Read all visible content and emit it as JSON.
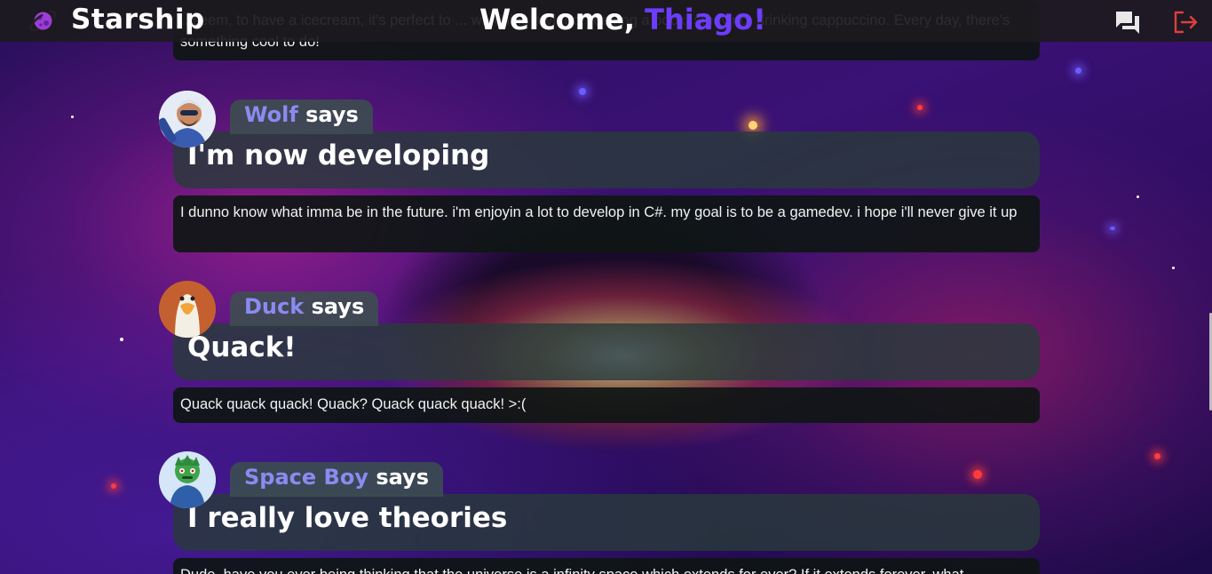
{
  "app": {
    "title": "Starship",
    "logo_icon": "planet-logo-icon"
  },
  "header": {
    "welcome_prefix": "Welcome, ",
    "welcome_name": "Thiago!",
    "chat_icon": "chat-icon",
    "logout_icon": "logout-icon"
  },
  "posts": [
    {
      "user": "",
      "title": "",
      "body": "...seem, to have a icecream, it's perfect to ... watching a video, reading a book, studying, drinking cappuccino. Every day, there's something cool to do!"
    },
    {
      "user": "Wolf",
      "verb": "says",
      "title": "I'm now developing",
      "body": "I dunno know what imma be in the future. i'm enjoyin a lot to develop in C#. my goal is to be a gamedev. i hope i'll never give it up"
    },
    {
      "user": "Duck",
      "verb": "says",
      "title": "Quack!",
      "body": "Quack quack quack! Quack? Quack quack quack! >:("
    },
    {
      "user": "Space Boy",
      "verb": "says",
      "title": "I really love theories",
      "body": "Dude, have you ever being thinking that the universe is a infinity space which extends for ever? If it extends forever, what"
    }
  ],
  "colors": {
    "accent": "#6d3cff",
    "username": "#8a8bf0",
    "logout": "#e0403a"
  }
}
